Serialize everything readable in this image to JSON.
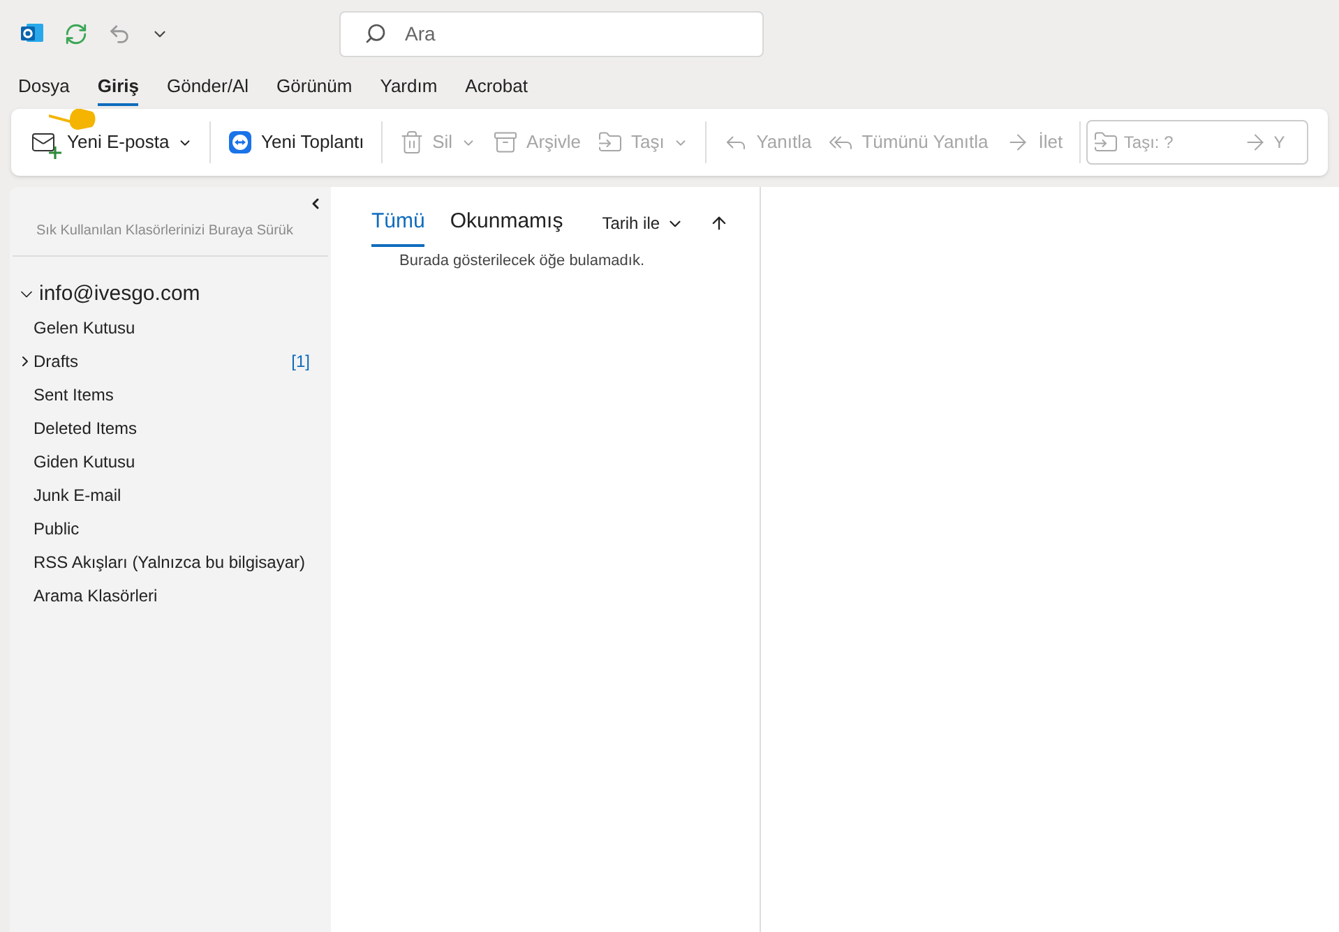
{
  "search": {
    "placeholder": "Ara"
  },
  "menu_tabs": [
    {
      "label": "Dosya",
      "selected": false
    },
    {
      "label": "Giriş",
      "selected": true
    },
    {
      "label": "Gönder/Al",
      "selected": false
    },
    {
      "label": "Görünüm",
      "selected": false
    },
    {
      "label": "Yardım",
      "selected": false
    },
    {
      "label": "Acrobat",
      "selected": false
    }
  ],
  "ribbon": [
    {
      "kind": "new-mail",
      "label": "Yeni E-posta",
      "disabled": false,
      "dropdown": true
    },
    {
      "kind": "separator"
    },
    {
      "kind": "meeting",
      "label": "Yeni Toplantı",
      "disabled": false,
      "dropdown": false
    },
    {
      "kind": "separator"
    },
    {
      "kind": "delete",
      "label": "Sil",
      "disabled": true,
      "dropdown": true
    },
    {
      "kind": "archive",
      "label": "Arşivle",
      "disabled": true,
      "dropdown": false
    },
    {
      "kind": "move",
      "label": "Taşı",
      "disabled": true,
      "dropdown": true
    },
    {
      "kind": "separator"
    },
    {
      "kind": "reply",
      "label": "Yanıtla",
      "disabled": true,
      "dropdown": false
    },
    {
      "kind": "reply-all",
      "label": "Tümünü Yanıtla",
      "disabled": true,
      "dropdown": false
    },
    {
      "kind": "forward",
      "label": "İlet",
      "disabled": true,
      "dropdown": false
    },
    {
      "kind": "separator"
    }
  ],
  "quick_steps": [
    {
      "kind": "move",
      "label": "Taşı: ?"
    },
    {
      "kind": "forward",
      "label": "Y"
    }
  ],
  "favorites_hint": "Sık Kullanılan Klasörlerinizi Buraya Sürük",
  "account": {
    "name": "info@ivesgo.com",
    "expanded": true,
    "folders": [
      {
        "name": "Gelen Kutusu"
      },
      {
        "name": "Drafts",
        "expanded": false,
        "count": "[1]"
      },
      {
        "name": "Sent Items"
      },
      {
        "name": "Deleted Items"
      },
      {
        "name": "Giden Kutusu"
      },
      {
        "name": "Junk E-mail"
      },
      {
        "name": "Public"
      },
      {
        "name": "RSS Akışları (Yalnızca bu bilgisayar)"
      },
      {
        "name": "Arama Klasörleri"
      }
    ]
  },
  "filters": [
    {
      "label": "Tümü",
      "selected": true
    },
    {
      "label": "Okunmamış",
      "selected": false
    }
  ],
  "sort": {
    "label": "Tarih ile"
  },
  "empty_message": "Burada gösterilecek öğe bulamadık."
}
